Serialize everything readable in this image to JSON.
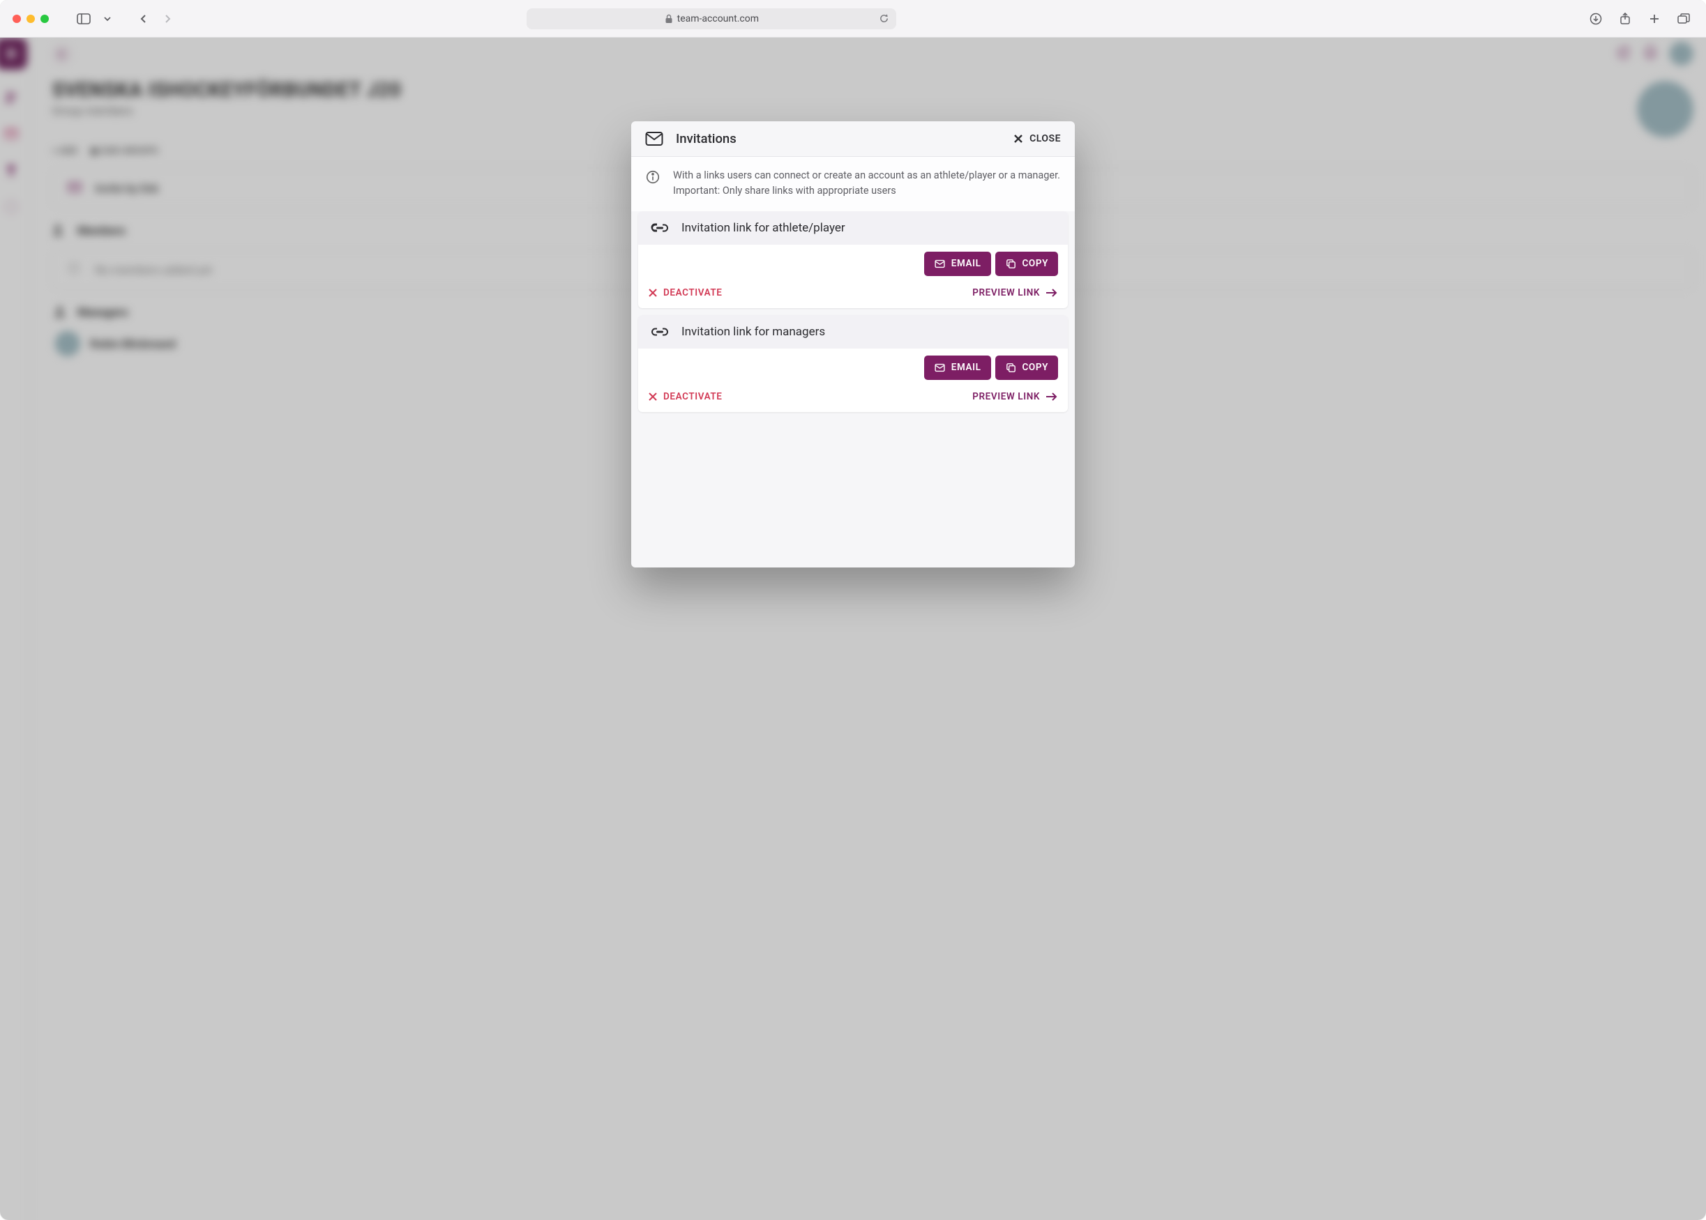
{
  "browser": {
    "url_host": "team-account.com"
  },
  "bg": {
    "page_title": "SVENSKA ISHOCKEYFÖRBUNDET J20",
    "page_subtitle": "Group members",
    "toolbar": {
      "add": "ADD",
      "subgroups": "SUB-GROUPS"
    },
    "invite_row": "Invite by link",
    "members_title": "Members",
    "members_empty": "No members added yet",
    "managers_title": "Managers",
    "manager_name": "Robin Blickmand"
  },
  "modal": {
    "title": "Invitations",
    "close": "CLOSE",
    "info": "With a links users can connect or create an account as an athlete/player or a manager. Important: Only share links with appropriate users",
    "cards": [
      {
        "title": "Invitation link for athlete/player",
        "email": "EMAIL",
        "copy": "COPY",
        "deactivate": "DEACTIVATE",
        "preview": "PREVIEW LINK"
      },
      {
        "title": "Invitation link for managers",
        "email": "EMAIL",
        "copy": "COPY",
        "deactivate": "DEACTIVATE",
        "preview": "PREVIEW LINK"
      }
    ]
  }
}
